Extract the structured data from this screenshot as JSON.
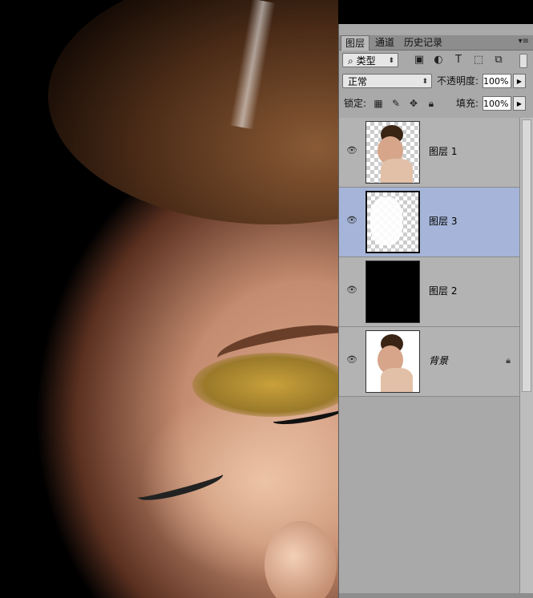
{
  "panel": {
    "tabs": [
      {
        "label": "图层",
        "active": true
      },
      {
        "label": "通道",
        "active": false
      },
      {
        "label": "历史记录",
        "active": false
      }
    ],
    "filter": {
      "kind_label": "类型",
      "icons": [
        "image-icon",
        "adjustment-icon",
        "type-icon",
        "shape-icon",
        "smart-object-icon"
      ]
    },
    "blend_mode": "正常",
    "opacity_label": "不透明度:",
    "opacity_value": "100%",
    "lock_label": "锁定:",
    "fill_label": "填充:",
    "fill_value": "100%",
    "layers": [
      {
        "name": "图层 1",
        "selected": false,
        "visible": true,
        "thumb": "portrait-transparent"
      },
      {
        "name": "图层 3",
        "selected": true,
        "visible": true,
        "thumb": "white-on-transparent"
      },
      {
        "name": "图层 2",
        "selected": false,
        "visible": true,
        "thumb": "black-fill"
      },
      {
        "name": "背景",
        "selected": false,
        "visible": true,
        "thumb": "portrait-white",
        "locked": true,
        "italic": true
      }
    ]
  }
}
